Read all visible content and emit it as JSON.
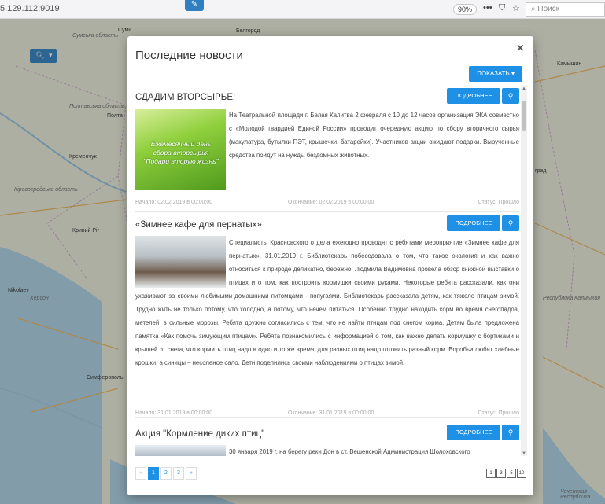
{
  "browser": {
    "url": "5.129.112:9019",
    "zoom": "90%",
    "search_placeholder": "Поиск",
    "menu_icon": "ellipsis-icon",
    "pocket_icon": "pocket-icon",
    "bookmark_icon": "star-icon"
  },
  "map": {
    "regions": [
      "Сумська область",
      "Полтавська область",
      "Кіровоградська область",
      "Херсон",
      "Республика Калмыкия",
      "Чеченская Республика"
    ],
    "cities": [
      "Суми",
      "Белгород",
      "Полта",
      "Кременчук",
      "Кривий Ріг",
      "Nikolaev",
      "Simferopol",
      "Симферополь",
      "Камышин",
      "град"
    ]
  },
  "modal": {
    "title": "Последние новости",
    "show_label": "ПОКАЗАТЬ",
    "close_label": "×"
  },
  "news": [
    {
      "title": "СДАДИМ ВТОРСЫРЬЕ!",
      "more_label": "ПОДРОБНЕЕ",
      "image_text": {
        "line1": "Ежемесячный день",
        "line2": "сбора вторсырья",
        "line3": "\"Подари вторую жизнь\""
      },
      "text": "На Театральной площади г. Белая Калитва 2 февраля с 10 до 12 часов организация ЭКА совместно с «Молодой гвардией Единой России» проводит очередную акцию по сбору вторичного сырья (макулатура, бутылки ПЭТ, крышечки, батарейки). Участников акции ожидают подарки. Вырученные средства пойдут на нужды бездомных животных.",
      "start": "Начало: 02.02.2019 в 00:00:00",
      "end": "Окончание: 02.02.2019 в 00:00:00",
      "status": "Статус: Прошло"
    },
    {
      "title": "«Зимнее кафе для пернатых»",
      "more_label": "ПОДРОБНЕЕ",
      "text": "Специалисты Красновского отдела ежегодно проводят с ребятами мероприятие «Зимнее кафе для пернатых». 31.01.2019 г. Библиотекарь побеседовала о том, что такое экология и как важно относиться к природе деликатно, бережно. Людмила Вадимовна провела обзор книжной выставки о птицах и о том, как построить кормушки своими руками. Некоторые ребята рассказали, как они ухаживают за своими любимыми домашними питомцами - попугаями. Библиотекарь рассказала детям, как тяжело птицам зимой. Трудно жить не только потому, что холодно, а потому, что нечем питаться. Особенно трудно находить корм во время снегопадов, метелей, в сильные морозы. Ребята дружно согласились с тем, что не найти птицам под снегом корма. Детям была предложена памятка «Как помочь зимующим птицам». Ребята познакомились с информацией о том, как важно делать кормушку с бортиками и крышей от снега, что кормить птиц надо в одно и то же время, для разных птиц надо готовить разный корм. Воробьи любят хлебные крошки, а синицы – несоленое сало. Дети поделились своими наблюдениями о птицах зимой.",
      "start": "Начало: 31.01.2019 в 00:00:00",
      "end": "Окончание: 31.01.2019 в 00:00:00",
      "status": "Статус: Прошло"
    },
    {
      "title": "Акция \"Кормление диких птиц\"",
      "more_label": "ПОДРОБНЕЕ",
      "text": "30 января 2019 г. на берегу реки Дон в ст. Вешенской Администрация Шолоховского"
    }
  ],
  "pager": {
    "prev": "«",
    "pages": [
      "1",
      "2",
      "3"
    ],
    "next": "»",
    "sizes": [
      "1",
      "3",
      "5",
      "10"
    ]
  },
  "colors": {
    "accent": "#1e90e6",
    "map_water": "#a9cfe3"
  }
}
